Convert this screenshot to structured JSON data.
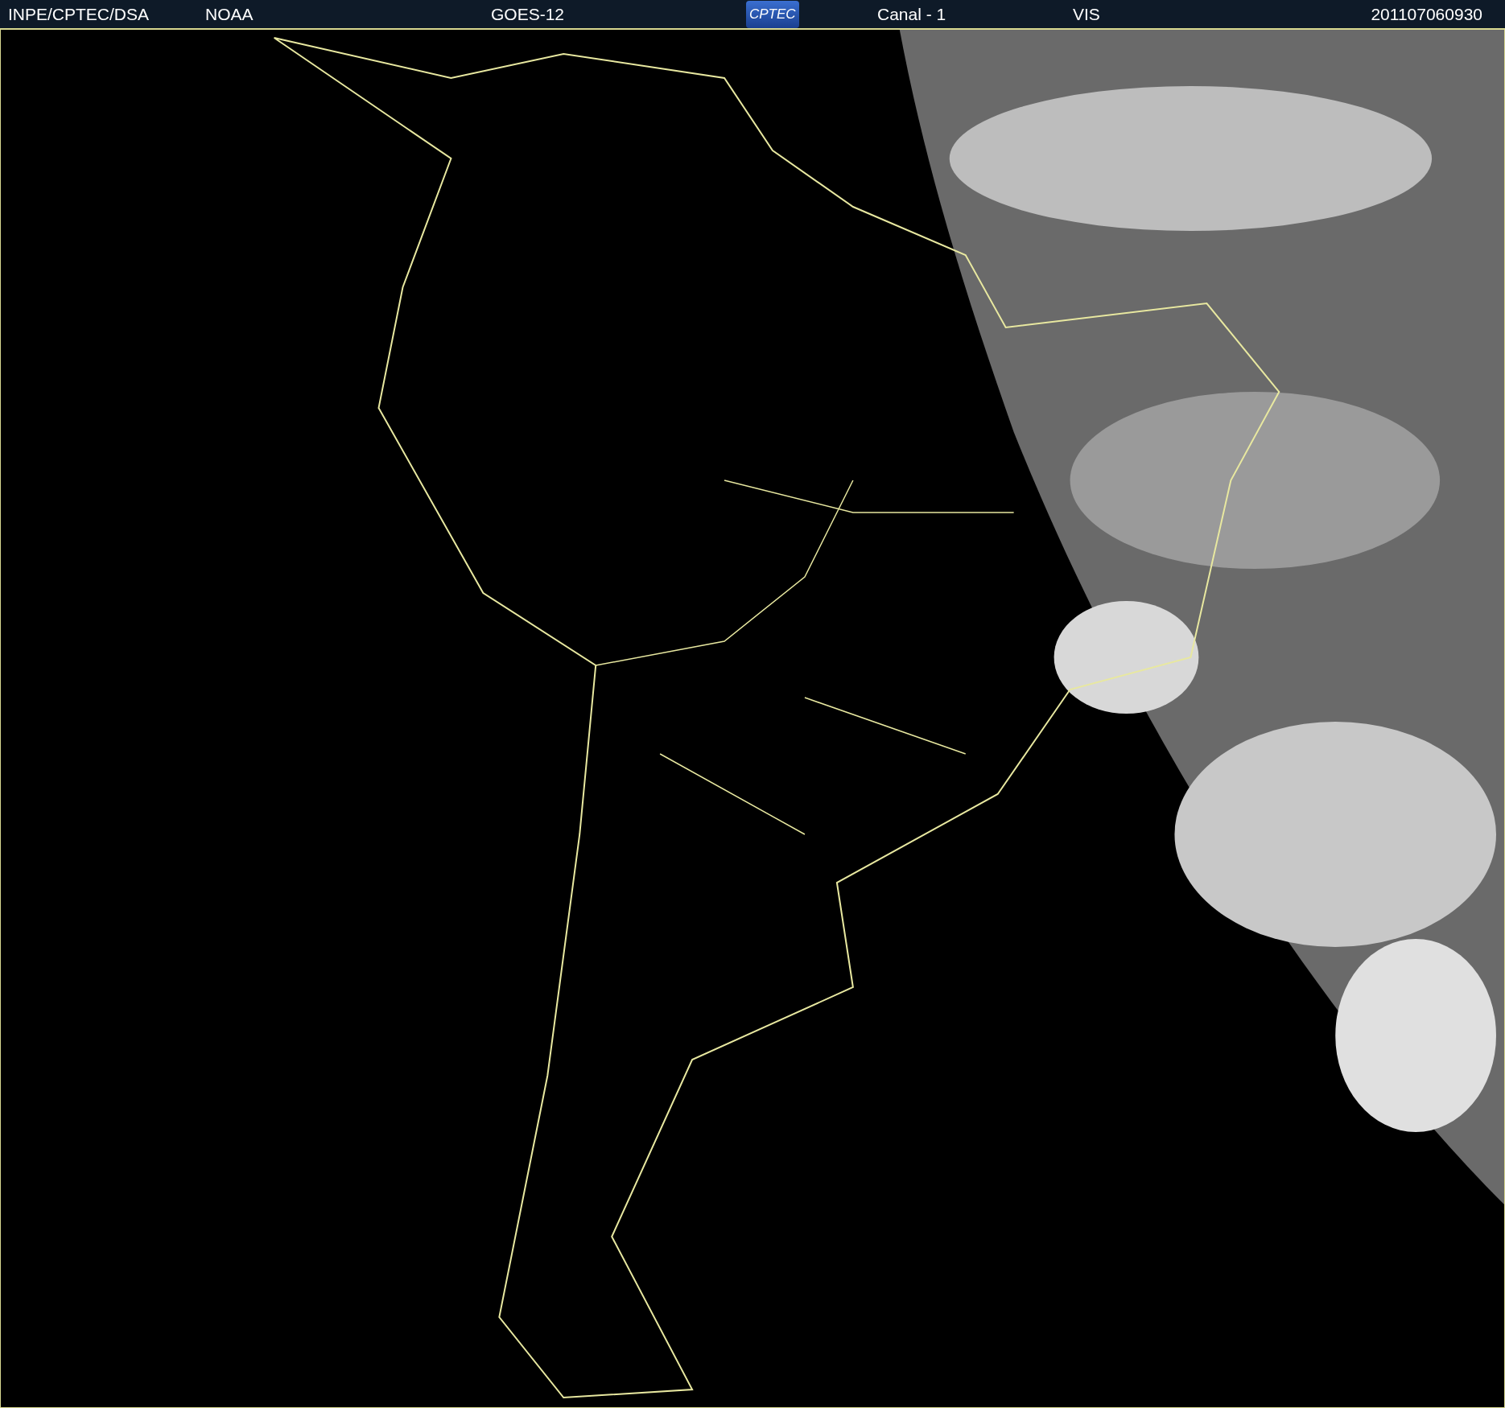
{
  "header": {
    "items": [
      {
        "kind": "text",
        "text": "INPE/CPTEC/DSA"
      },
      {
        "kind": "text",
        "text": "NOAA"
      },
      {
        "kind": "text",
        "text": "GOES-12"
      },
      {
        "kind": "logo",
        "text": "CPTEC"
      },
      {
        "kind": "text",
        "text": "Canal - 1"
      },
      {
        "kind": "text",
        "text": "VIS"
      },
      {
        "kind": "text",
        "text": "201107060930"
      }
    ]
  }
}
